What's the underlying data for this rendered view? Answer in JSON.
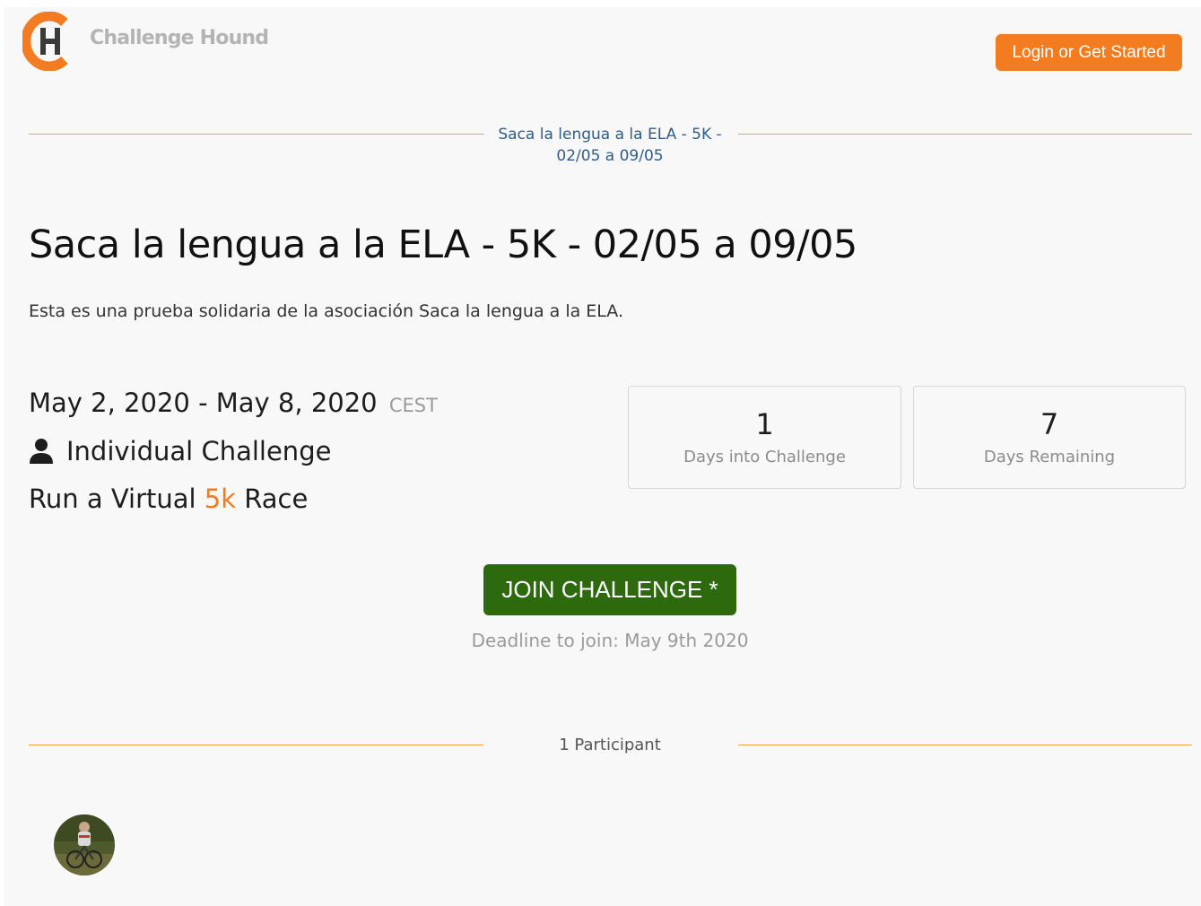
{
  "header": {
    "brand": "Challenge Hound",
    "login_label": "Login or Get Started"
  },
  "challenge": {
    "subtitle": "Saca la lengua a la ELA - 5K - 02/05 a 09/05",
    "title": "Saca la lengua a la ELA - 5K - 02/05 a 09/05",
    "description": "Esta es una prueba solidaria de la asociación Saca la lengua a la ELA.",
    "date_range": "May 2, 2020 - May 8, 2020",
    "timezone": "CEST",
    "type": "Individual Challenge",
    "activity_prefix": "Run a Virtual ",
    "activity_distance": "5k",
    "activity_suffix": " Race"
  },
  "stats": [
    {
      "value": "1",
      "label": "Days into Challenge"
    },
    {
      "value": "7",
      "label": "Days Remaining"
    }
  ],
  "join": {
    "label": "JOIN CHALLENGE *",
    "deadline": "Deadline to join: May 9th 2020"
  },
  "participants": {
    "label": "1 Participant"
  },
  "colors": {
    "brand_orange": "#f47c20",
    "join_green": "#2d6a0e",
    "subtitle_blue": "#2f5d8a"
  },
  "icons": {
    "logo": "challenge-hound-logo",
    "user": "user-icon",
    "avatar": "participant-avatar"
  }
}
